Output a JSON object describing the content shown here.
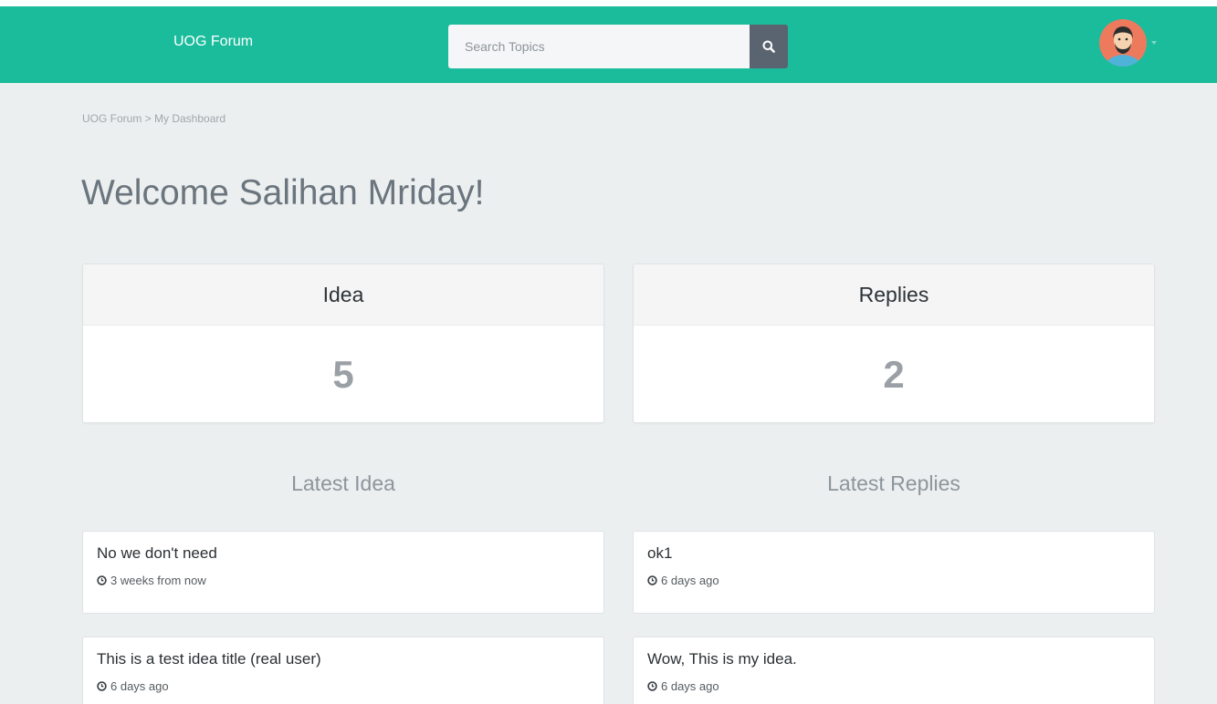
{
  "navbar": {
    "brand": "UOG Forum",
    "search_placeholder": "Search Topics",
    "search_icon": "search-icon",
    "avatar_icon": "user-avatar",
    "caret_icon": "caret-down-icon"
  },
  "breadcrumb": {
    "text": "UOG Forum > My Dashboard"
  },
  "welcome": "Welcome Salihan Mriday!",
  "stats": [
    {
      "label": "Idea",
      "value": "5"
    },
    {
      "label": "Replies",
      "value": "2"
    }
  ],
  "latest_idea": {
    "title": "Latest Idea",
    "items": [
      {
        "title": "No we don't need",
        "time": "3 weeks from now"
      },
      {
        "title": "This is a test idea title (real user)",
        "time": "6 days ago"
      }
    ]
  },
  "latest_replies": {
    "title": "Latest Replies",
    "items": [
      {
        "title": "ok1",
        "time": "6 days ago"
      },
      {
        "title": "Wow, This is my idea.",
        "time": "6 days ago"
      }
    ]
  },
  "colors": {
    "navbar": "#1abc9c",
    "background": "#eceff0",
    "search_button": "#5a6471"
  }
}
